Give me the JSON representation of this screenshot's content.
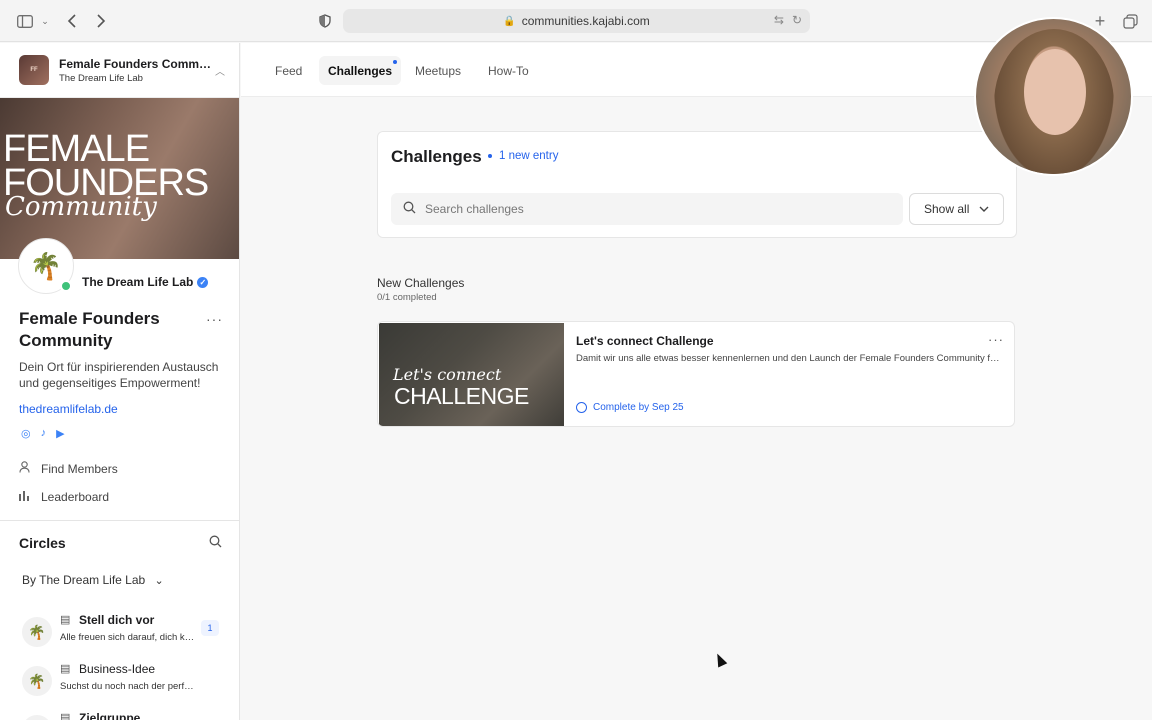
{
  "browser": {
    "url": "communities.kajabi.com"
  },
  "space": {
    "name": "Female Founders Community",
    "owner": "The Dream Life Lab",
    "logo_text": "FEMALE FOUNDERS"
  },
  "banner": {
    "line1": "FEMALE",
    "line2": "FOUNDERS",
    "line3": "Community"
  },
  "profile": {
    "owner_name": "The Dream Life Lab",
    "title": "Female Founders Community",
    "description": "Dein Ort für inspirierenden Austausch und gegenseitiges Empowerment!",
    "link": "thedreamlifelab.de",
    "nav": {
      "find_members": "Find Members",
      "leaderboard": "Leaderboard"
    }
  },
  "circles": {
    "title": "Circles",
    "filter": "By The Dream Life Lab",
    "items": [
      {
        "name": "Stell dich vor",
        "desc": "Alle freuen sich darauf, dich kennenzulernen",
        "badge": "1"
      },
      {
        "name": "Business-Idee",
        "desc": "Suchst du noch nach der perfekten Idee?"
      },
      {
        "name": "Zielgruppe",
        "desc": ""
      }
    ]
  },
  "tabs": [
    {
      "label": "Feed"
    },
    {
      "label": "Challenges"
    },
    {
      "label": "Meetups"
    },
    {
      "label": "How-To"
    }
  ],
  "challenges": {
    "title": "Challenges",
    "new_entry": "1 new entry",
    "search_placeholder": "Search challenges",
    "show_all": "Show all",
    "section_title": "New Challenges",
    "section_sub": "0/1 completed",
    "card": {
      "thumb_line1": "Let's connect",
      "thumb_line2": "CHALLENGE",
      "name": "Let's connect Challenge",
      "desc": "Damit wir uns alle etwas besser kennenlernen und den Launch der Female Founders Community feiern können",
      "due": "Complete by Sep 25"
    }
  }
}
